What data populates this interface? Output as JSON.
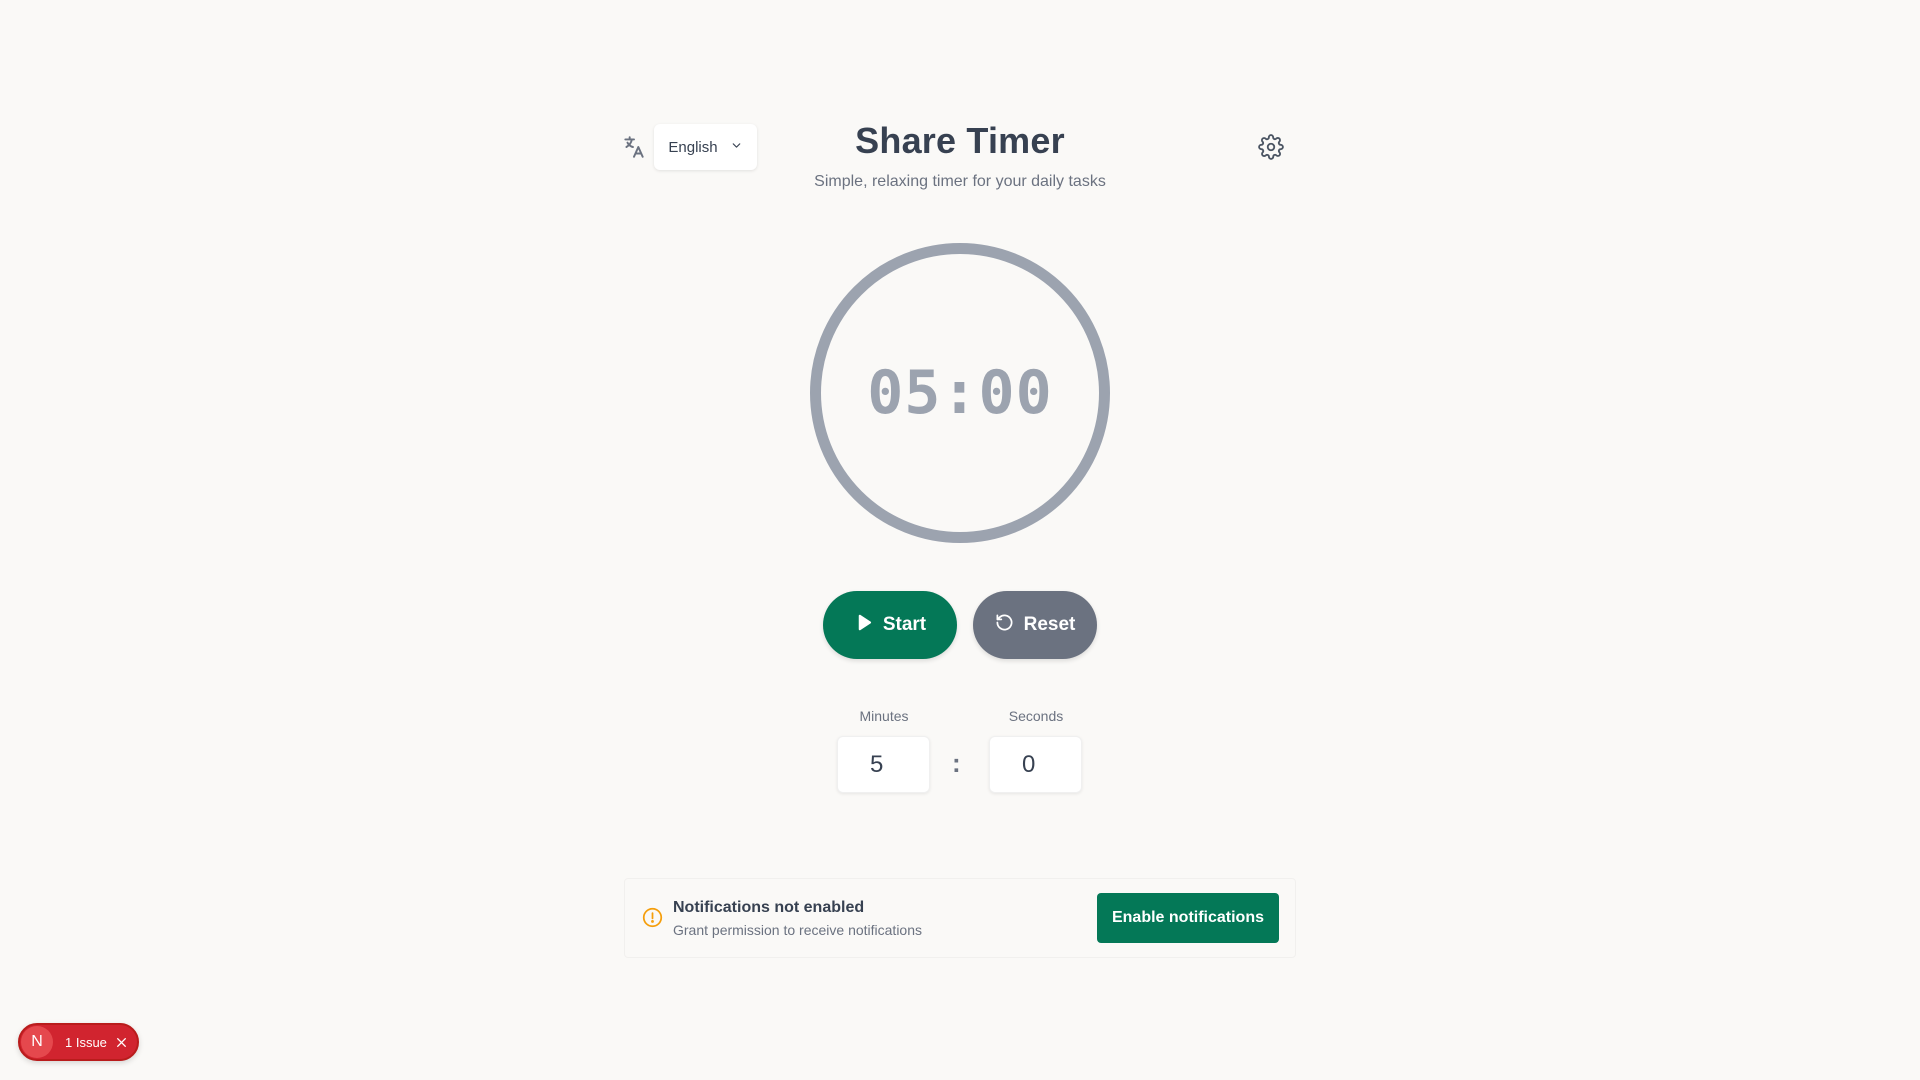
{
  "header": {
    "language_icon": "translate-icon",
    "language_selected": "English",
    "title": "Share Timer",
    "subtitle": "Simple, relaxing timer for your daily tasks",
    "settings_icon": "gear-icon"
  },
  "timer": {
    "display": "05:00",
    "ring_color": "#9ca3af"
  },
  "controls": {
    "start_label": "Start",
    "start_icon": "play-icon",
    "reset_label": "Reset",
    "reset_icon": "reset-icon",
    "start_color": "#047857",
    "reset_color": "#6b7280"
  },
  "inputs": {
    "minutes_label": "Minutes",
    "minutes_value": "5",
    "separator": ":",
    "seconds_label": "Seconds",
    "seconds_value": "0"
  },
  "notification": {
    "icon": "warning-icon",
    "title": "Notifications not enabled",
    "description": "Grant permission to receive notifications",
    "button_label": "Enable notifications"
  },
  "dev_badge": {
    "letter": "N",
    "text": "1 Issue",
    "color": "#d1242f"
  }
}
